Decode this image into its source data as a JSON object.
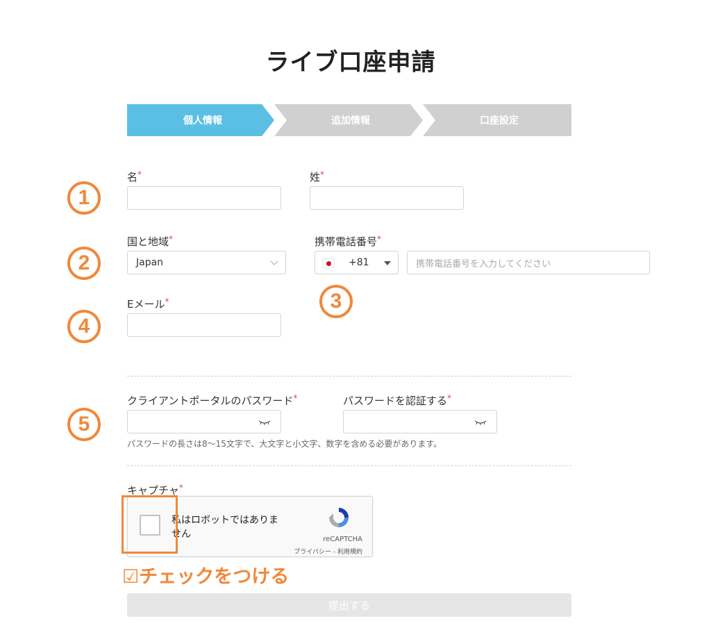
{
  "page": {
    "title": "ライブ口座申請"
  },
  "steps": [
    "個人情報",
    "追加情報",
    "口座設定"
  ],
  "annotations": {
    "circle_labels": [
      "1",
      "2",
      "3",
      "4",
      "5"
    ],
    "check_note": "☑チェックをつける"
  },
  "form": {
    "first_name": {
      "label": "名",
      "value": ""
    },
    "last_name": {
      "label": "姓",
      "value": ""
    },
    "country": {
      "label": "国と地域",
      "value": "Japan"
    },
    "phone": {
      "label": "携帯電話番号",
      "dial_code": "+81",
      "placeholder": "携帯電話番号を入力してください",
      "value": ""
    },
    "email": {
      "label": "Eメール",
      "value": ""
    },
    "password": {
      "label": "クライアントポータルのパスワード",
      "value": ""
    },
    "password_confirm": {
      "label": "パスワードを認証する",
      "value": ""
    },
    "password_hint": "パスワードの長さは8〜15文字で、大文字と小文字、数字を含める必要があります。",
    "captcha": {
      "label": "キャプチャ",
      "checkbox_text": "私はロボットではありません",
      "brand": "reCAPTCHA",
      "links": "プライバシー - 利用規約"
    },
    "required_mark": "*",
    "submit_label": "提出する"
  },
  "colors": {
    "step_active": "#5bbfe4",
    "step_inactive": "#d0d0d0",
    "annotation": "#f0883a",
    "required": "#e04848"
  }
}
